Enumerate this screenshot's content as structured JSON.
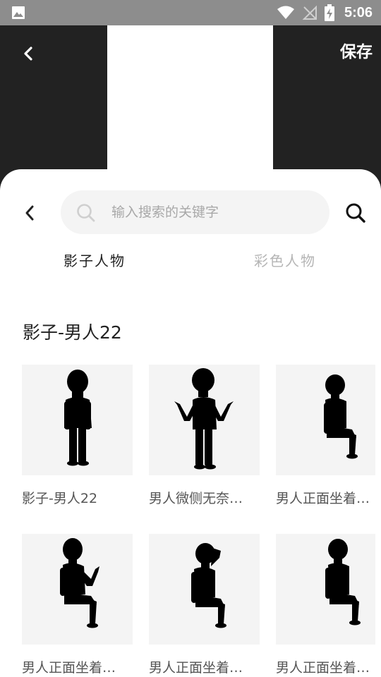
{
  "status_bar": {
    "time": "5:06",
    "icons": [
      "gallery-icon",
      "wifi-icon",
      "no-signal-icon",
      "battery-charging-icon"
    ]
  },
  "editor": {
    "save_label": "保存",
    "back_icon": "chevron-left-icon"
  },
  "search": {
    "placeholder": "输入搜索的关键字",
    "value": ""
  },
  "tabs": [
    {
      "label": "影子人物",
      "active": true
    },
    {
      "label": "彩色人物",
      "active": false
    }
  ],
  "section": {
    "title": "影子-男人22"
  },
  "items": [
    {
      "label": "影子-男人22"
    },
    {
      "label": "男人微侧无奈…"
    },
    {
      "label": "男人正面坐着…"
    },
    {
      "label": "男人正面坐着…"
    },
    {
      "label": "男人正面坐着…"
    },
    {
      "label": "男人正面坐着…"
    }
  ],
  "colors": {
    "dark_bg": "#222222",
    "status_bar": "#8d8d8d",
    "sheet_bg": "#ffffff",
    "thumb_bg": "#f4f4f4",
    "active_tab": "#222222",
    "inactive_tab": "#b5b5b5"
  }
}
